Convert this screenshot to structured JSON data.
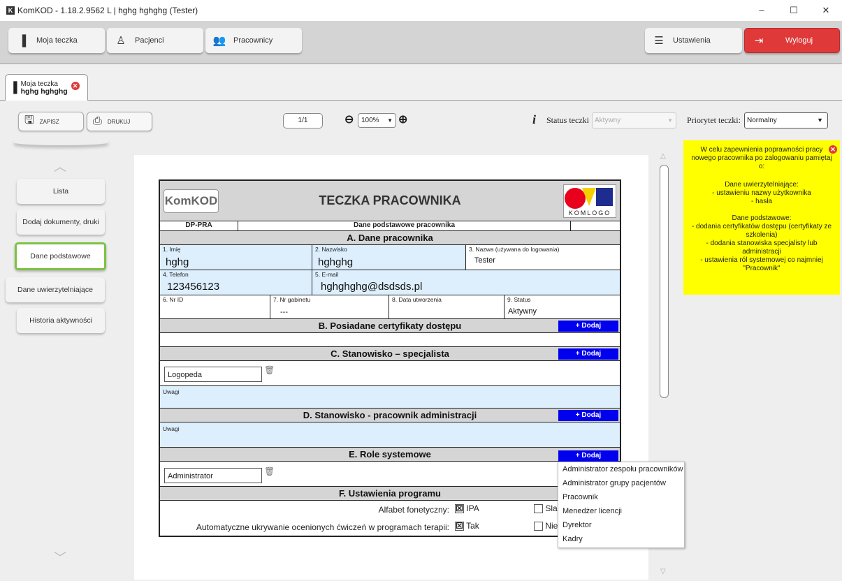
{
  "window": {
    "title": "KomKOD - 1.18.2.9562 L | hghg hghghg (Tester)",
    "app_icon": "K",
    "minimize": "–",
    "maximize": "☐",
    "close": "✕"
  },
  "nav": {
    "moja_teczka": "Moja teczka",
    "pacjenci": "Pacjenci",
    "pracownicy": "Pracownicy",
    "ustawienia": "Ustawienia",
    "wyloguj": "Wyloguj"
  },
  "tab": {
    "title": "Moja teczka",
    "subtitle": "hghg hghghg"
  },
  "toolbar": {
    "zapisz": "ZAPISZ",
    "drukuj": "DRUKUJ",
    "page": "1/1",
    "zoom": "100%",
    "status_label": "Status teczki",
    "status_value": "Aktywny",
    "priority_label": "Priorytet teczki:",
    "priority_value": "Normalny"
  },
  "sidebar": {
    "items": [
      "Lista",
      "Dodaj dokumenty, druki",
      "Dane podstawowe",
      "Dane uwierzytelniające",
      "Historia aktywności"
    ]
  },
  "form": {
    "logo": "KomKOD",
    "title": "TECZKA PRACOWNIKA",
    "komlogo": "KOMLOGO",
    "code": "DP-PRA",
    "subtitle": "Dane podstawowe pracownika",
    "secA": "A. Dane pracownika",
    "f1_label": "1. Imię",
    "f1_value": "hghg",
    "f2_label": "2. Nazwisko",
    "f2_value": "hghghg",
    "f3_label": "3. Nazwa (używana do logowania)",
    "f3_value": "Tester",
    "f4_label": "4. Telefon",
    "f4_value": "123456123",
    "f5_label": "5. E-mail",
    "f5_value": "hghghghg@dsdsds.pl",
    "f6_label": "6. Nr ID",
    "f7_label": "7. Nr gabinetu",
    "f7_value": "---",
    "f8_label": "8. Data utworzenia",
    "f9_label": "9. Status",
    "f9_value": "Aktywny",
    "secB": "B. Posiadane certyfikaty dostępu",
    "secC": "C. Stanowisko – specjalista",
    "c_value": "Logopeda",
    "uwagi": "Uwagi",
    "secD": "D. Stanowisko - pracownik administracji",
    "secE": "E. Role systemowe",
    "e_value": "Administrator",
    "secF": "F. Ustawienia programu",
    "alfabet_label": "Alfabet fonetyczny:",
    "alfabet_opt1": "IPA",
    "alfabet_opt2": "Sla",
    "auto_label": "Automatyczne ukrywanie ocenionych ćwiczeń w programach terapii:",
    "auto_opt1": "Tak",
    "auto_opt2": "Nie",
    "dodaj": "+ Dodaj"
  },
  "dropdown": [
    "Administrator zespołu pracowników",
    "Administrator grupy pacjentów",
    "Pracownik",
    "Menedżer licencji",
    "Dyrektor",
    "Kadry"
  ],
  "info": {
    "l1": "W celu zapewnienia poprawności pracy nowego pracownika po zalogowaniu pamiętaj o:",
    "l2": "Dane uwierzytelniające:",
    "l3": "- ustawieniu nazwy użytkownika",
    "l4": "- hasła",
    "l5": "Dane podstawowe:",
    "l6": "- dodania certyfikatów dostępu (certyfikaty ze szkolenia)",
    "l7": "- dodania stanowiska specjalisty lub administracji",
    "l8": "- ustawienia ról systemowej co najmniej \"Pracownik\""
  },
  "colors": {
    "accent_green": "#7cc242",
    "logout_red": "#e0393a",
    "add_blue": "#0000ee",
    "info_yellow": "#ffff00"
  }
}
